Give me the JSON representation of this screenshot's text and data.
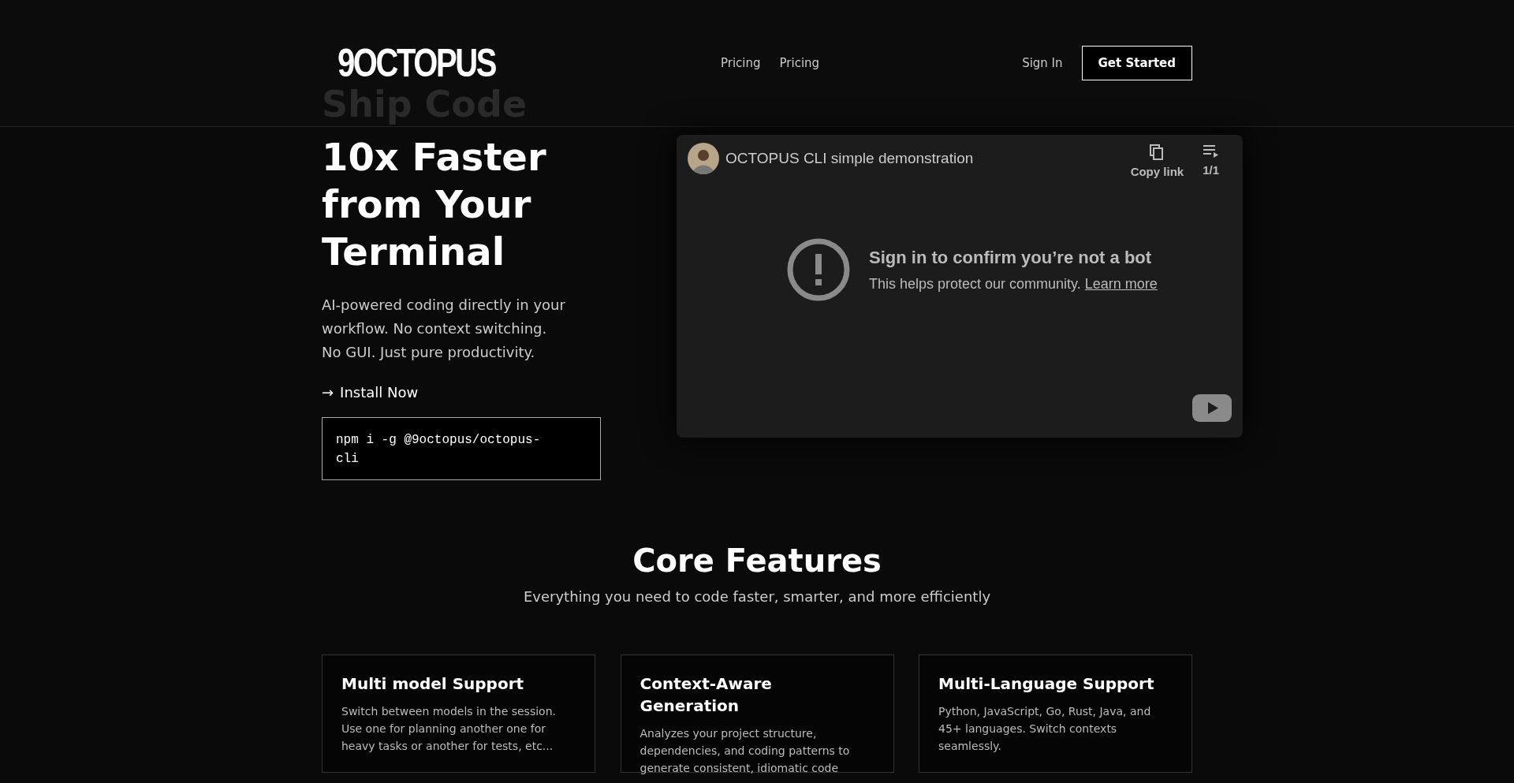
{
  "header": {
    "logo": "9OCTOPUS",
    "nav": [
      {
        "label": "Pricing"
      },
      {
        "label": "Pricing"
      }
    ],
    "sign_in": "Sign In",
    "cta": "Get Started"
  },
  "hero": {
    "heading_behind_header": "Ship Code",
    "heading_lines": [
      "10x Faster",
      "from Your",
      "Terminal"
    ],
    "lead_lines": [
      "AI-powered coding directly in your",
      "workflow. No context switching.",
      "No GUI. Just pure productivity."
    ],
    "install_link": {
      "icon": "→",
      "label": "Install Now"
    },
    "command": "npm i -g @9octopus/octopus-cli"
  },
  "video": {
    "title": "OCTOPUS CLI simple demonstration",
    "actions": [
      {
        "kind": "copy",
        "label": "Copy link"
      },
      {
        "kind": "playlist",
        "label": "1/1"
      }
    ],
    "message": {
      "title": "Sign in to confirm you’re not a bot",
      "text": "This helps protect our community.",
      "link": "Learn more"
    }
  },
  "features": {
    "title": "Core Features",
    "subtitle": "Everything you need to code faster, smarter, and more efficiently",
    "cards": [
      {
        "title": "Multi model Support",
        "text": "Switch between models in the session. Use one for planning another one for heavy tasks or another for tests, etc..."
      },
      {
        "title": "Context-Aware Generation",
        "text": "Analyzes your project structure, dependencies, and coding patterns to generate consistent, idiomatic code"
      },
      {
        "title": "Multi-Language Support",
        "text": "Python, JavaScript, Go, Rust, Java, and 45+ languages. Switch contexts seamlessly."
      }
    ]
  }
}
